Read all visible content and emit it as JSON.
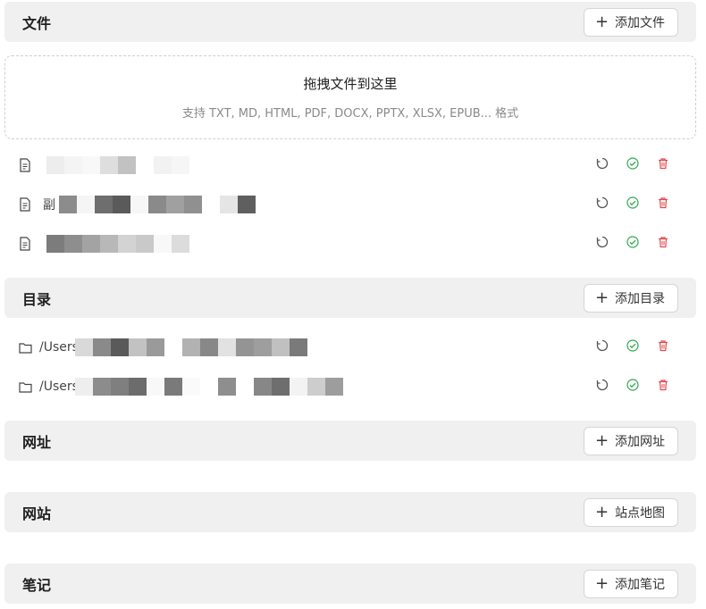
{
  "sections": {
    "files": {
      "title": "文件",
      "add_label": "添加文件"
    },
    "dirs": {
      "title": "目录",
      "add_label": "添加目录"
    },
    "urls": {
      "title": "网址",
      "add_label": "添加网址"
    },
    "sites": {
      "title": "网站",
      "add_label": "站点地图"
    },
    "notes": {
      "title": "笔记",
      "add_label": "添加笔记"
    }
  },
  "dropzone": {
    "title": "拖拽文件到这里",
    "subtitle": "支持 TXT, MD, HTML, PDF, DOCX, PPTX, XLSX, EPUB... 格式"
  },
  "files": [
    {
      "name_prefix": ""
    },
    {
      "name_prefix": "副"
    },
    {
      "name_prefix": ""
    }
  ],
  "directories": [
    {
      "name_prefix": "/Users"
    },
    {
      "name_prefix": "/Users"
    }
  ],
  "colors": {
    "header_bg": "#f0f0f0",
    "success": "#2fa84f",
    "danger": "#e5484d",
    "neutral_icon": "#555555"
  },
  "icons": {
    "file": "file-text-icon",
    "folder": "folder-icon",
    "refresh": "refresh-icon",
    "check": "check-circle-icon",
    "delete": "trash-icon",
    "plus": "plus-icon"
  }
}
